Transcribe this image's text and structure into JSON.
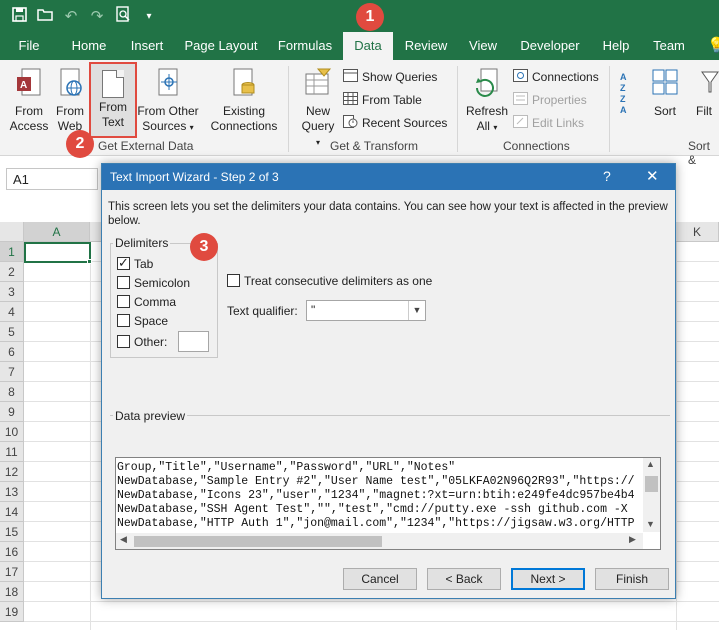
{
  "ribbon_tabs": [
    "File",
    "Home",
    "Insert",
    "Page Layout",
    "Formulas",
    "Data",
    "Review",
    "View",
    "Developer",
    "Help",
    "Team"
  ],
  "ribbon": {
    "from_access": [
      "From",
      "Access"
    ],
    "from_web": [
      "From",
      "Web"
    ],
    "from_text": [
      "From",
      "Text"
    ],
    "from_other": [
      "From Other",
      "Sources"
    ],
    "existing_connections": [
      "Existing",
      "Connections"
    ],
    "group_get_external": "Get External Data",
    "new_query": [
      "New",
      "Query"
    ],
    "show_queries": "Show Queries",
    "from_table": "From Table",
    "recent_sources": "Recent Sources",
    "group_get_transform": "Get & Transform",
    "refresh_all": [
      "Refresh",
      "All"
    ],
    "connections": "Connections",
    "properties": "Properties",
    "edit_links": "Edit Links",
    "group_connections": "Connections",
    "sort": "Sort",
    "filter": "Filt",
    "group_sort": "Sort &"
  },
  "name_box": "A1",
  "columns": [
    "A",
    "K"
  ],
  "rows": [
    "1",
    "2",
    "3",
    "4",
    "5",
    "6",
    "7",
    "8",
    "9",
    "10",
    "11",
    "12",
    "13",
    "14",
    "15",
    "16",
    "17",
    "18",
    "19"
  ],
  "dialog": {
    "title": "Text Import Wizard - Step 2 of 3",
    "help": "?",
    "close": "✕",
    "intro": "This screen lets you set the delimiters your data contains.  You can see how your text is affected in the preview below.",
    "delimiters_label": "Delimiters",
    "tab": "Tab",
    "semicolon": "Semicolon",
    "comma": "Comma",
    "space": "Space",
    "other": "Other:",
    "treat_consecutive": "Treat consecutive delimiters as one",
    "text_qualifier_label": "Text qualifier:",
    "text_qualifier_value": "\"",
    "data_preview_label": "Data preview",
    "preview_lines": [
      "Group,\"Title\",\"Username\",\"Password\",\"URL\",\"Notes\"",
      "NewDatabase,\"Sample Entry #2\",\"User Name test\",\"05LKFA02N96Q2R93\",\"https://",
      "NewDatabase,\"Icons 23\",\"user\",\"1234\",\"magnet:?xt=urn:btih:e249fe4dc957be4b4",
      "NewDatabase,\"SSH Agent Test\",\"\",\"test\",\"cmd://putty.exe -ssh github.com -X",
      "NewDatabase,\"HTTP Auth 1\",\"jon@mail.com\",\"1234\",\"https://jigsaw.w3.org/HTTP"
    ],
    "cancel": "Cancel",
    "back": "< Back",
    "next": "Next >",
    "finish": "Finish"
  },
  "badges": [
    "1",
    "2",
    "3"
  ],
  "colors": {
    "excel_green": "#217346",
    "dialog_blue": "#2b73b5",
    "badge_red": "#e04a3f"
  }
}
